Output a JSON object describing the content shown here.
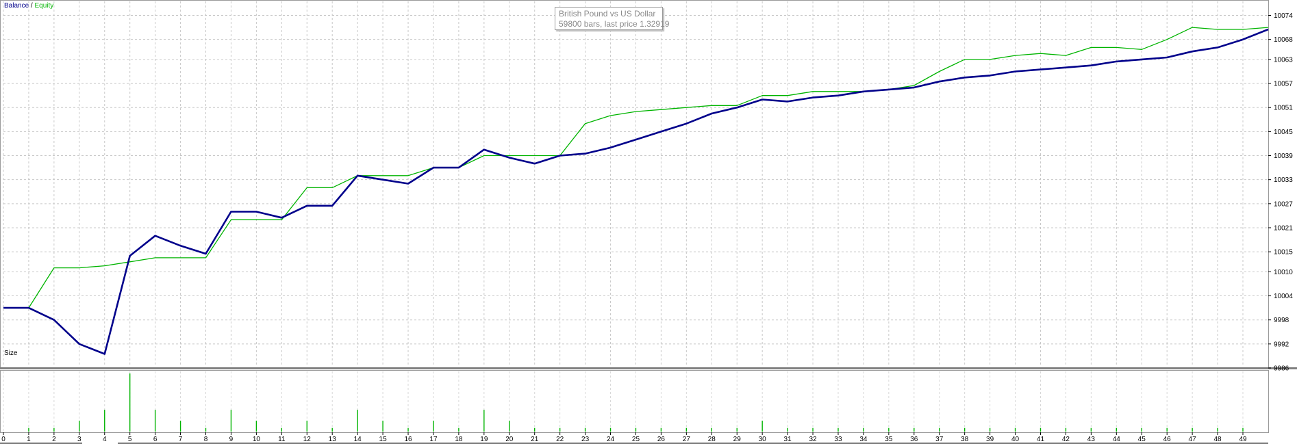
{
  "legend": {
    "balance_label": "Balance",
    "separator": " / ",
    "equity_label": "Equity",
    "balance_color": "#00008b",
    "equity_color": "#00b400"
  },
  "tooltip": {
    "line1": "British Pound vs US Dollar",
    "line2": "59800 bars, last price 1.32919"
  },
  "size_panel": {
    "label": "Size"
  },
  "chart_data": [
    {
      "type": "line",
      "x": [
        0,
        1,
        2,
        3,
        4,
        5,
        6,
        7,
        8,
        9,
        10,
        11,
        12,
        13,
        14,
        15,
        16,
        17,
        18,
        19,
        20,
        21,
        22,
        23,
        24,
        25,
        26,
        27,
        28,
        29,
        30,
        31,
        32,
        33,
        34,
        35,
        36,
        37,
        38,
        39,
        40,
        41,
        42,
        43,
        44,
        45,
        46,
        47,
        48,
        49,
        50
      ],
      "series": [
        {
          "name": "Balance",
          "color": "#00008b",
          "values": [
            10001,
            10001,
            9998,
            9992,
            9989.5,
            10014,
            10019,
            10016.5,
            10014.5,
            10025,
            10025,
            10023.5,
            10026.5,
            10026.5,
            10034,
            10033,
            10032,
            10036,
            10036,
            10040.5,
            10038.5,
            10037,
            10039,
            10039.5,
            10041,
            10043,
            10045,
            10047,
            10049.5,
            10051,
            10053,
            10052.5,
            10053.5,
            10054,
            10055,
            10055.5,
            10056,
            10057.5,
            10058.5,
            10059,
            10060,
            10060.5,
            10061,
            10061.5,
            10062.5,
            10063,
            10063.5,
            10065,
            10066,
            10068,
            10070.5
          ]
        },
        {
          "name": "Equity",
          "color": "#00b400",
          "values": [
            10001,
            10001,
            10011,
            10011,
            10011.5,
            10012.5,
            10013.5,
            10013.5,
            10013.5,
            10023,
            10023,
            10023,
            10031,
            10031,
            10034,
            10034,
            10034,
            10036,
            10036,
            10039,
            10039,
            10039,
            10039,
            10047,
            10049,
            10050,
            10050.5,
            10051,
            10051.5,
            10051.5,
            10054,
            10054,
            10055,
            10055,
            10055,
            10055.5,
            10056.5,
            10060,
            10063,
            10063,
            10064,
            10064.5,
            10064,
            10066,
            10066,
            10065.5,
            10068,
            10071,
            10070.5,
            10070.5,
            10071
          ]
        }
      ],
      "y_ticks": [
        10074,
        10068,
        10063,
        10057,
        10051,
        10045,
        10039,
        10033,
        10027,
        10021,
        10015,
        10010,
        10004,
        9998,
        9992,
        9986
      ],
      "ylim": [
        9986,
        10077.5
      ],
      "x_ticks": [
        0,
        1,
        2,
        3,
        4,
        5,
        6,
        7,
        8,
        9,
        10,
        11,
        12,
        13,
        14,
        15,
        16,
        17,
        18,
        19,
        20,
        21,
        22,
        23,
        24,
        25,
        26,
        27,
        28,
        29,
        30,
        31,
        32,
        33,
        34,
        35,
        36,
        37,
        38,
        39,
        40,
        41,
        42,
        43,
        44,
        45,
        46,
        47,
        48,
        49
      ],
      "grid": true
    },
    {
      "type": "bar",
      "name": "Size",
      "color": "#00b400",
      "x": [
        1,
        2,
        3,
        4,
        5,
        6,
        7,
        8,
        9,
        10,
        11,
        12,
        13,
        14,
        15,
        16,
        17,
        18,
        19,
        20,
        21,
        22,
        23,
        24,
        25,
        26,
        27,
        28,
        29,
        30,
        31,
        32,
        33,
        34,
        35,
        36,
        37,
        38,
        39,
        40,
        41,
        42,
        43,
        44,
        45,
        46,
        47,
        48,
        49
      ],
      "values": [
        1,
        1,
        3,
        6,
        16,
        6,
        3,
        1,
        6,
        3,
        1,
        3,
        1,
        6,
        3,
        1,
        3,
        1,
        6,
        3,
        1,
        1,
        1,
        1,
        1,
        1,
        1,
        1,
        1,
        3,
        1,
        1,
        1,
        1,
        1,
        1,
        1,
        1,
        1,
        1,
        1,
        1,
        1,
        1,
        1,
        1,
        1,
        1,
        1
      ],
      "ylim": [
        0,
        16
      ]
    }
  ]
}
